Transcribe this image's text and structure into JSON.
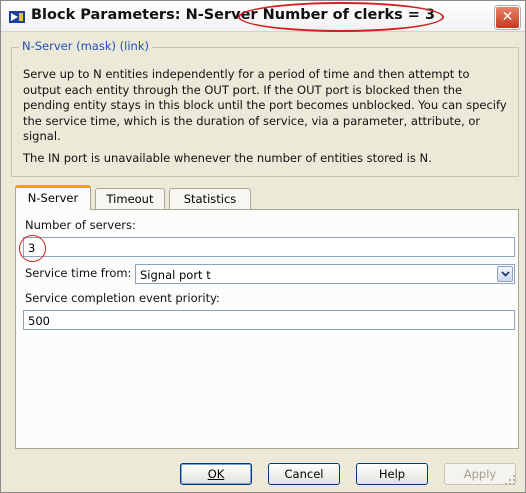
{
  "window": {
    "title": "Block Parameters: N-Server Number of clerks = 3",
    "close_glyph": "✕",
    "annotation_color": "#d42020"
  },
  "mask": {
    "legend": "N-Server (mask) (link)",
    "description": "Serve up to N entities independently for a period of time and then attempt to output each entity through the OUT port. If the OUT port is blocked then the pending entity stays in this block until the port becomes unblocked. You can specify the service time, which is the duration of service, via a parameter, attribute, or signal.",
    "note": "The IN port is unavailable whenever the number of entities stored is N."
  },
  "tabs": [
    {
      "label": "N-Server",
      "active": true
    },
    {
      "label": "Timeout",
      "active": false
    },
    {
      "label": "Statistics",
      "active": false
    }
  ],
  "params": {
    "servers_label": "Number of servers:",
    "servers_value": "3",
    "service_time_label": "Service time from:",
    "service_time_value": "Signal port t",
    "priority_label": "Service completion event priority:",
    "priority_value": "500"
  },
  "buttons": {
    "ok": "OK",
    "cancel": "Cancel",
    "help": "Help",
    "apply": "Apply"
  },
  "icons": {
    "app": "simulink-block-icon",
    "close": "close-icon",
    "dropdown": "chevron-down-icon",
    "resize": "resize-grip-icon"
  }
}
